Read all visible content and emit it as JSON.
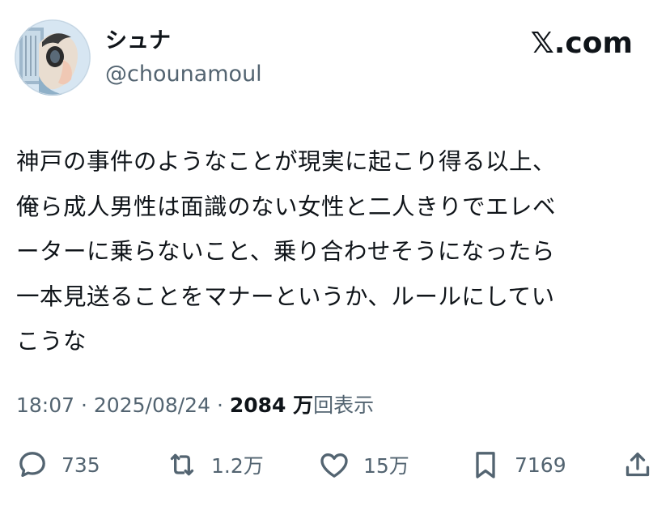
{
  "author": {
    "display_name": "シュナ",
    "handle": "@chounamoul",
    "avatar_icon": "profile-avatar-illustration"
  },
  "brand": "𝕏.com",
  "tweet": {
    "lines": [
      "神戸の事件のようなことが現実に起こり得る以上、",
      "俺ら成人男性は面識のない女性と二人きりでエレベ",
      "ーターに乗らないこと、乗り合わせそうになったら",
      "一本見送ることをマナーというか、ルールにしてい",
      "こうな"
    ]
  },
  "meta": {
    "time": "18:07",
    "separator": "·",
    "date": "2025/08/24",
    "views_count": "2084 万",
    "views_label": "回表示"
  },
  "actions": {
    "replies": {
      "icon": "reply-icon",
      "count": "735"
    },
    "reposts": {
      "icon": "repost-icon",
      "count": "1.2万"
    },
    "likes": {
      "icon": "heart-icon",
      "count": "15万"
    },
    "bookmarks": {
      "icon": "bookmark-icon",
      "count": "7169"
    },
    "share": {
      "icon": "share-icon"
    }
  },
  "colors": {
    "primary_text": "#0f1419",
    "secondary_text": "#536471"
  }
}
